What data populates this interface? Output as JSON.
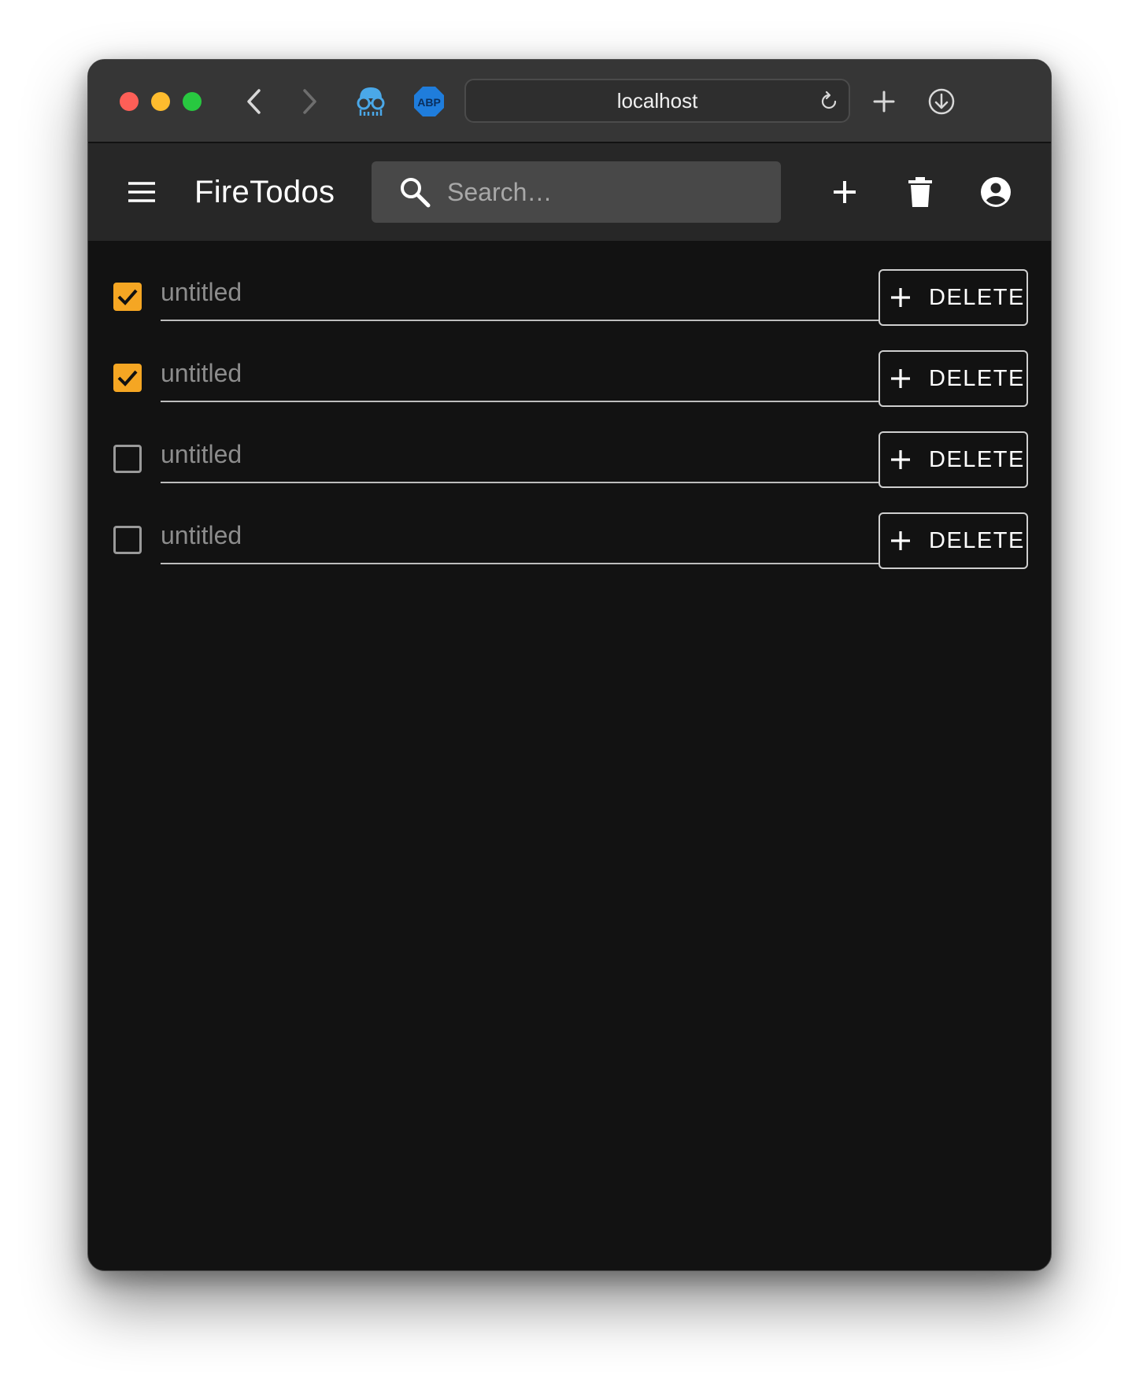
{
  "browser": {
    "address": "localhost",
    "extensions": [
      {
        "name": "glasses-extension-icon"
      },
      {
        "name": "adblock-plus-icon",
        "label": "ABP"
      }
    ]
  },
  "app": {
    "title": "FireTodos",
    "search": {
      "placeholder": "Search…",
      "value": ""
    },
    "accent_color": "#f5a623"
  },
  "todos": [
    {
      "placeholder": "untitled",
      "value": "",
      "checked": true,
      "button_label": "DELETE"
    },
    {
      "placeholder": "untitled",
      "value": "",
      "checked": true,
      "button_label": "DELETE"
    },
    {
      "placeholder": "untitled",
      "value": "",
      "checked": false,
      "button_label": "DELETE"
    },
    {
      "placeholder": "untitled",
      "value": "",
      "checked": false,
      "button_label": "DELETE"
    }
  ]
}
